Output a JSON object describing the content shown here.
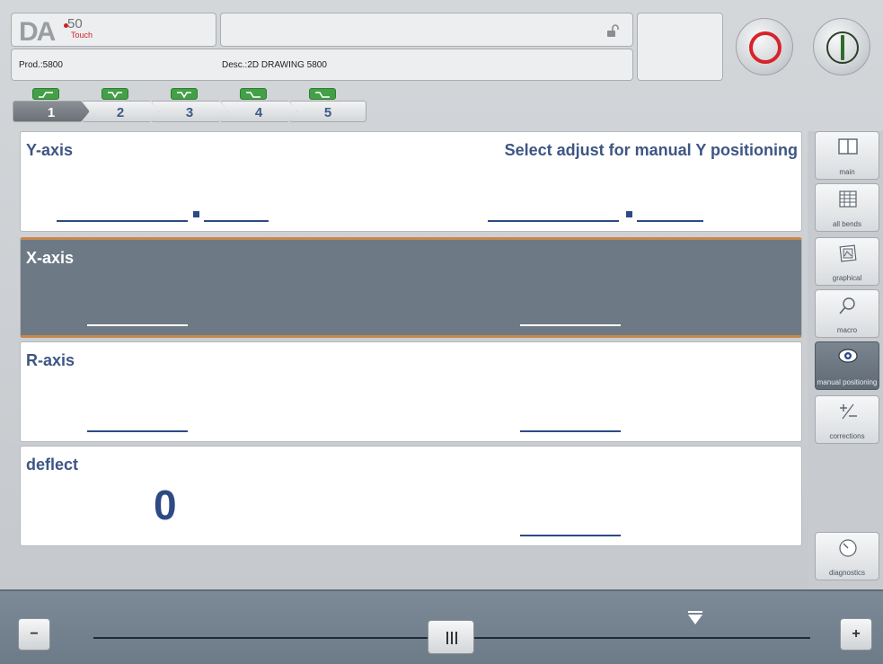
{
  "header": {
    "logo_text": "DA",
    "logo_model": "50",
    "logo_sub": "Touch",
    "message": "",
    "product": "Prod.:5800",
    "description": "Desc.:2D DRAWING 5800"
  },
  "controls": {
    "stop_icon": "stop-circle-icon",
    "start_icon": "start-icon"
  },
  "bends": [
    {
      "number": "1",
      "status": "up"
    },
    {
      "number": "2",
      "status": "down"
    },
    {
      "number": "3",
      "status": "down"
    },
    {
      "number": "4",
      "status": "down"
    },
    {
      "number": "5",
      "status": "down"
    }
  ],
  "selected_bend": "1",
  "panels": {
    "y_axis": {
      "title": "Y-axis",
      "message": "Select adjust for manual Y positioning"
    },
    "x_axis": {
      "title": "X-axis"
    },
    "r_axis": {
      "title": "R-axis"
    },
    "deflect": {
      "title": "deflect",
      "value": "0"
    }
  },
  "sidebar": {
    "items": [
      {
        "label": "main",
        "icon": "main-icon"
      },
      {
        "label": "all bends",
        "icon": "table-icon"
      },
      {
        "label": "graphical",
        "icon": "graphical-icon"
      },
      {
        "label": "macro",
        "icon": "magnifier-icon"
      },
      {
        "label": "manual positioning",
        "icon": "eye-icon",
        "active": true
      },
      {
        "label": "corrections",
        "icon": "plus-minus-icon"
      },
      {
        "label": "diagnostics",
        "icon": "gauge-icon"
      }
    ]
  },
  "slider": {
    "minus_label": "−",
    "plus_label": "+",
    "position": 0.5
  },
  "colors": {
    "accent_blue": "#3d5684",
    "selected_panel": "#6d7985",
    "selected_border": "#c8874a",
    "stop_red": "#d8232a",
    "badge_green": "#43a047"
  }
}
